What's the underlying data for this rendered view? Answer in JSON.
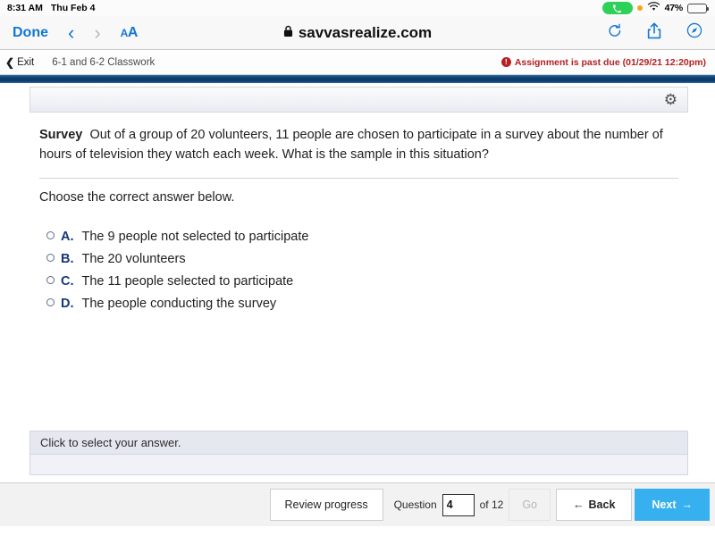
{
  "status_bar": {
    "time": "8:31 AM",
    "date": "Thu Feb 4",
    "battery_percent": "47%",
    "call_icon": "phone-icon",
    "recording_dot": "orange-dot-indicator",
    "wifi_icon": "wifi-icon",
    "battery_icon": "battery-icon",
    "battery_level": 47,
    "call_pill_color": "#2ed158",
    "dot_color": "#f7a417"
  },
  "browser": {
    "done_label": "Done",
    "back_icon": "chevron-left-icon",
    "forward_icon": "chevron-right-icon",
    "text_size_label_big": "A",
    "text_size_label_small": "A",
    "lock_icon": "lock-icon",
    "url": "savvasrealize.com",
    "reload_icon": "reload-icon",
    "share_icon": "share-icon",
    "tabs_icon": "compass-icon",
    "accent": "#1277d4"
  },
  "app_bar": {
    "exit_label": "Exit",
    "exit_icon": "chevron-left-icon",
    "assignment_title": "6-1 and 6-2 Classwork",
    "warning_icon": "exclamation-circle-icon",
    "warning_text": "Assignment is past due (01/29/21 12:20pm)",
    "warning_color": "#b52025"
  },
  "panel": {
    "settings_icon": "gear-icon"
  },
  "question": {
    "label": "Survey",
    "text": "Out of a group of 20 volunteers, 11 people are chosen to participate in a survey about the number of hours of television they watch each week. What is the sample in this situation?",
    "prompt": "Choose the correct answer below.",
    "choices": [
      {
        "letter": "A.",
        "text": "The 9 people not selected to participate"
      },
      {
        "letter": "B.",
        "text": "The 20 volunteers"
      },
      {
        "letter": "C.",
        "text": "The 11 people selected to participate"
      },
      {
        "letter": "D.",
        "text": "The people conducting the survey"
      }
    ]
  },
  "answer_area": {
    "placeholder": "Click to select your answer."
  },
  "bottom_nav": {
    "review_label": "Review progress",
    "question_label": "Question",
    "question_value": "4",
    "of_label": "of 12",
    "go_label": "Go",
    "back_label": "Back",
    "back_icon": "arrow-left-icon",
    "next_label": "Next",
    "next_icon": "arrow-right-icon",
    "next_color": "#37b0ef"
  }
}
